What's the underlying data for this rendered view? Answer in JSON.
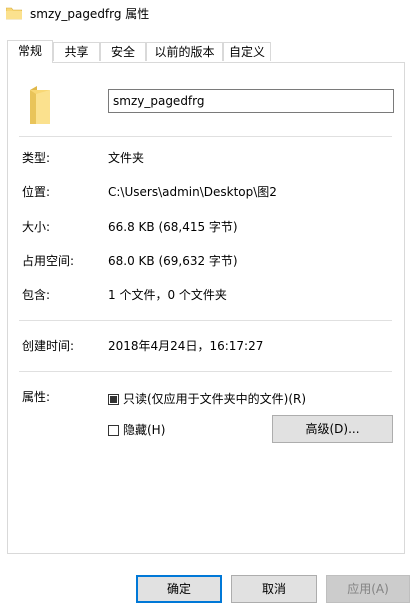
{
  "window": {
    "title": "smzy_pagedfrg 属性",
    "title_icon": "folder-icon"
  },
  "tabs": [
    {
      "label": "常规",
      "active": true
    },
    {
      "label": "共享",
      "active": false
    },
    {
      "label": "安全",
      "active": false
    },
    {
      "label": "以前的版本",
      "active": false
    },
    {
      "label": "自定义",
      "active": false
    }
  ],
  "general": {
    "folder_icon": "folder-icon",
    "name": "smzy_pagedfrg",
    "type_label": "类型:",
    "type_value": "文件夹",
    "location_label": "位置:",
    "location_value": "C:\\Users\\admin\\Desktop\\图2",
    "size_label": "大小:",
    "size_value": "66.8 KB (68,415 字节)",
    "size_on_disk_label": "占用空间:",
    "size_on_disk_value": "68.0 KB (69,632 字节)",
    "contains_label": "包含:",
    "contains_value": "1 个文件，0 个文件夹",
    "created_label": "创建时间:",
    "created_value": "2018年4月24日，16:17:27",
    "attributes_label": "属性:",
    "readonly_label": "只读(仅应用于文件夹中的文件)(R)",
    "readonly_state": "indeterminate",
    "hidden_label": "隐藏(H)",
    "hidden_checked": false,
    "advanced_button": "高级(D)..."
  },
  "footer": {
    "ok": "确定",
    "cancel": "取消",
    "apply": "应用(A)"
  },
  "colors": {
    "folder_yellow": "#f8d775",
    "folder_dark": "#e0b84a",
    "default_button_border": "#0078d7",
    "button_face": "#e1e1e1",
    "disabled_text": "#838383"
  }
}
